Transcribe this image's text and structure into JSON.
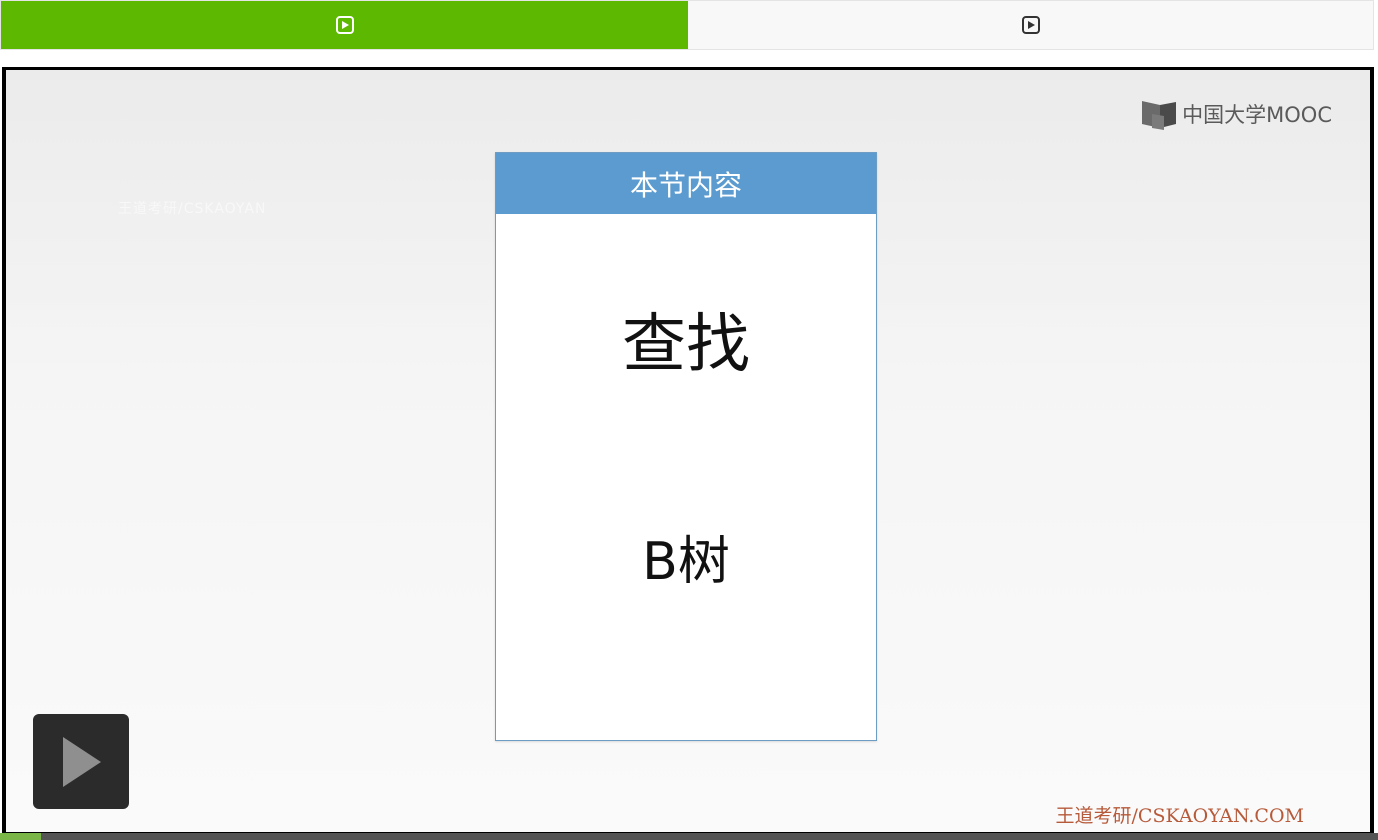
{
  "tabs": [
    {
      "icon": "play-square-icon",
      "active": true
    },
    {
      "icon": "play-square-icon",
      "active": false
    }
  ],
  "video": {
    "logo_text": "中国大学MOOC",
    "faint_text": "王道考研/CSKAOYAN",
    "card": {
      "header": "本节内容",
      "line1": "查找",
      "line2": "B树"
    },
    "watermark": "王道考研/CSKAOYAN.COM",
    "progress_fraction": 0.03
  },
  "colors": {
    "tab_active": "#5cb800",
    "card_header": "#5b9bcf",
    "watermark": "#b65a3a"
  }
}
